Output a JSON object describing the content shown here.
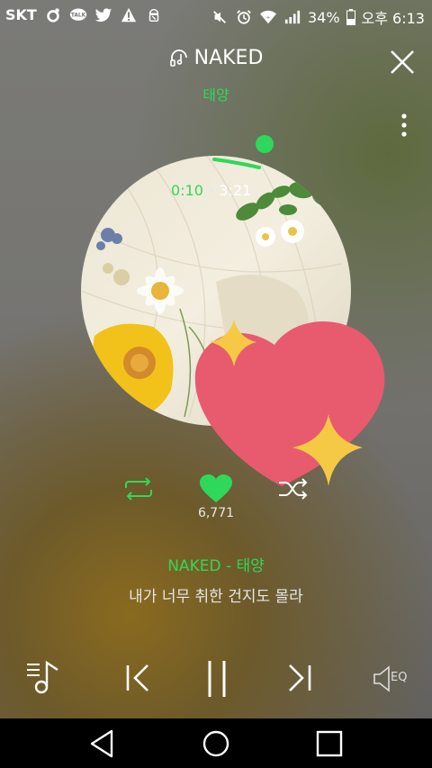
{
  "status_bar": {
    "carrier": "SKT",
    "icons_left": [
      "notification-icon",
      "kakaotalk-icon",
      "twitter-icon",
      "warning-icon",
      "android-debug-icon"
    ],
    "icons_right": [
      "mute-icon",
      "alarm-icon",
      "wifi-icon",
      "signal-icon"
    ],
    "battery": "34%",
    "time": "오후 6:13"
  },
  "player": {
    "title": "NAKED",
    "artist": "태양",
    "time_current": "0:10",
    "time_separator": "•",
    "time_total": "3:21",
    "progress_fraction": 0.05,
    "like_count": "6,771",
    "liked": true
  },
  "lyrics": {
    "title_line": "NAKED - 태양",
    "current_line": "내가 너무 취한 건지도 몰라"
  },
  "controls": {
    "eq_label": "EQ"
  },
  "colors": {
    "accent": "#2fd85a",
    "heart_sticker": "#e85a6e",
    "star": "#f6c945"
  }
}
